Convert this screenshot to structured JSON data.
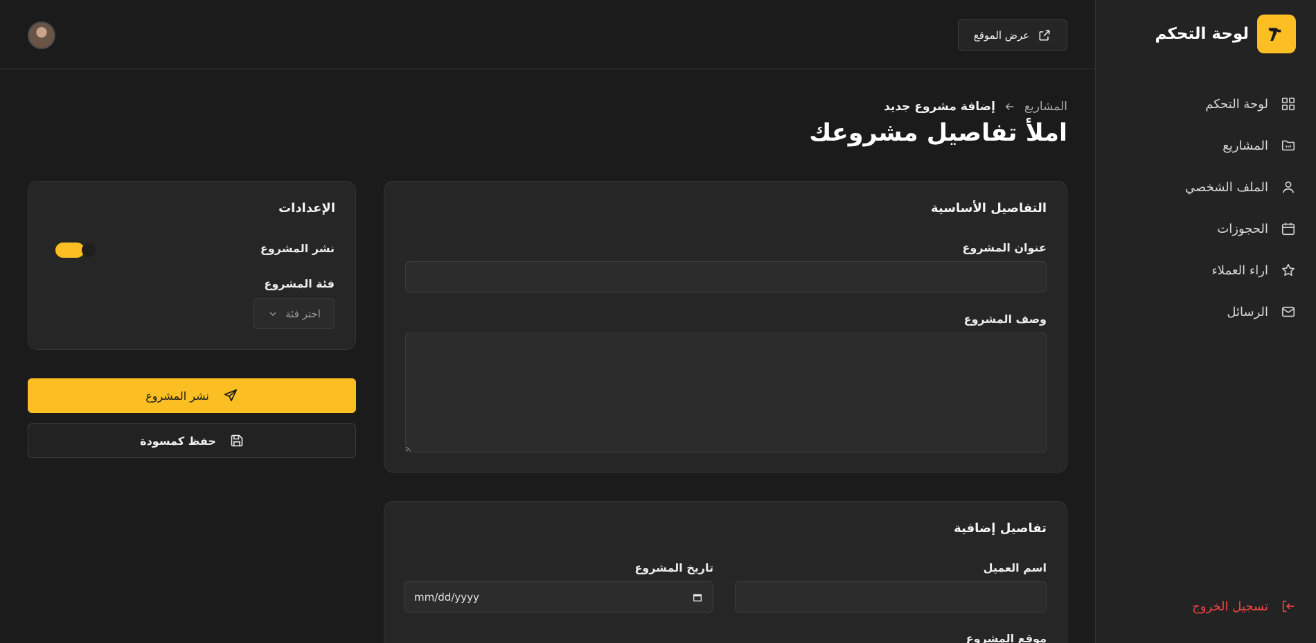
{
  "sidebar": {
    "brand_title": "لوحة التحكم",
    "brand_icon": "hammer-icon",
    "items": [
      {
        "label": "لوحة التحكم",
        "icon": "dashboard-grid-icon"
      },
      {
        "label": "المشاريع",
        "icon": "folder-icon"
      },
      {
        "label": "الملف الشخصي",
        "icon": "user-icon"
      },
      {
        "label": "الحجوزات",
        "icon": "calendar-icon"
      },
      {
        "label": "اراء العملاء",
        "icon": "star-icon"
      },
      {
        "label": "الرسائل",
        "icon": "mail-icon"
      }
    ],
    "logout_label": "تسجيل الخروج",
    "logout_color": "#ef4444"
  },
  "header": {
    "view_site_label": "عرض الموقع"
  },
  "page": {
    "breadcrumb_parent": "المشاريع",
    "breadcrumb_current": "إضافة مشروع جديد",
    "title": "املأ تفاصيل مشروعك"
  },
  "basic_details": {
    "title": "التفاصيل الأساسية",
    "project_title_label": "عنوان المشروع",
    "project_title_value": "",
    "description_label": "وصف المشروع",
    "description_value": ""
  },
  "extra_details": {
    "title": "تفاصيل إضافية",
    "client_name_label": "اسم العميل",
    "client_name_value": "",
    "project_date_label": "تاريخ المشروع",
    "project_date_placeholder": "mm/dd/yyyy",
    "project_location_label": "موقع المشروع"
  },
  "settings": {
    "title": "الإعدادات",
    "publish_toggle_label": "نشر المشروع",
    "publish_toggle_on": true,
    "category_label": "فئة المشروع",
    "category_placeholder": "اختر فئة"
  },
  "actions": {
    "publish_label": "نشر المشروع",
    "save_draft_label": "حفظ كمسودة"
  },
  "colors": {
    "accent": "#fbbf24",
    "background": "#1b1b1b",
    "card": "#262626"
  }
}
